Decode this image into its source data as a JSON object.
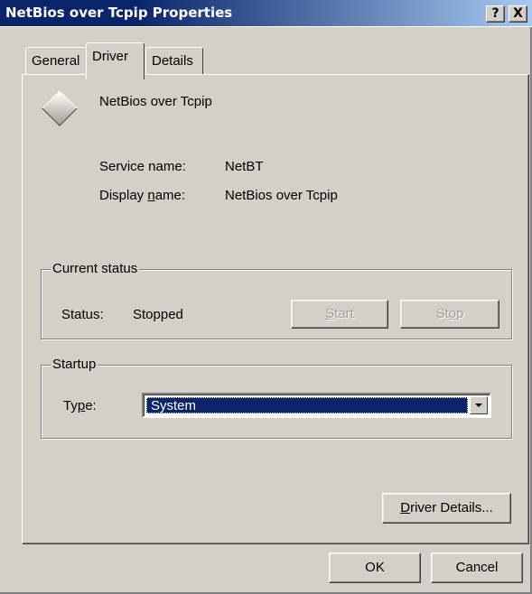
{
  "window": {
    "title": "NetBios over Tcpip Properties",
    "help_button": "?",
    "close_button": "X"
  },
  "tabs": [
    {
      "label": "General",
      "active": false
    },
    {
      "label": "Driver",
      "active": true
    },
    {
      "label": "Details",
      "active": false
    }
  ],
  "driver": {
    "name": "NetBios over Tcpip",
    "service_name_label": "Service name:",
    "service_name_value": "NetBT",
    "display_name_label_pre": "Display ",
    "display_name_label_key": "n",
    "display_name_label_post": "ame:",
    "display_name_value": "NetBios over Tcpip"
  },
  "current_status": {
    "legend": "Current status",
    "status_label": "Status:",
    "status_value": "Stopped",
    "start_key": "S",
    "start_rest": "tart",
    "stop_pre": "St",
    "stop_key": "o",
    "stop_post": "p"
  },
  "startup": {
    "legend": "Startup",
    "type_label_pre": "Ty",
    "type_label_key": "p",
    "type_label_post": "e:",
    "type_value": "System"
  },
  "buttons": {
    "driver_details_key": "D",
    "driver_details_rest": "river Details...",
    "ok": "OK",
    "cancel": "Cancel"
  },
  "colors": {
    "titlebar": "#0a246a",
    "face": "#d4d0c8",
    "selection": "#0a246a"
  }
}
